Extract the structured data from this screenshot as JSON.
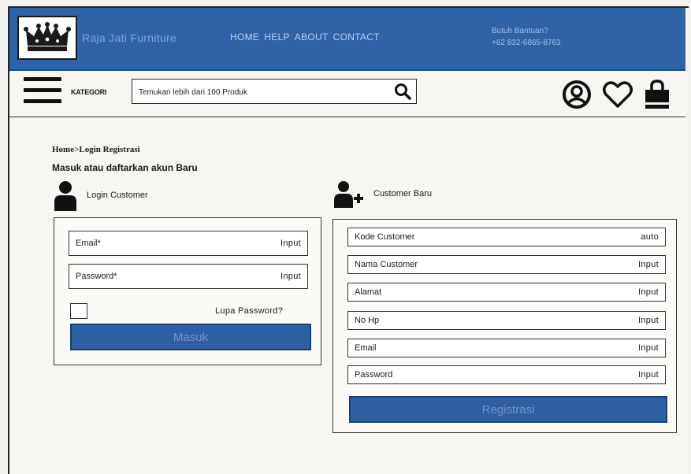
{
  "header": {
    "brand": "Raja Jati Furniture",
    "nav": [
      "HOME",
      "HELP",
      "ABOUT",
      "CONTACT"
    ],
    "help_title": "Butuh Bantuan?",
    "help_phone": "+62 832-6865-8763",
    "logo_icon": "crown-icon",
    "bar_color": "#2f63a8"
  },
  "searchbar": {
    "kategori_label": "KATEGORI",
    "placeholder": "Temukan lebih dari 100 Produk",
    "menu_icon": "hamburger-icon",
    "search_icon": "search-icon",
    "action_icons": [
      "user-icon",
      "heart-icon",
      "shopping-bag-icon"
    ]
  },
  "breadcrumb": "Home>Login Registrasi",
  "page_title": "Masuk atau daftarkan akun Baru",
  "login": {
    "title": "Login Customer",
    "icon": "user-icon",
    "fields": [
      {
        "label": "Email*",
        "value": "Input"
      },
      {
        "label": "Password*",
        "value": "Input"
      }
    ],
    "forgot_label": "Lupa Password?",
    "submit_label": "Masuk"
  },
  "register": {
    "title": "Customer Baru",
    "icon": "add-user-icon",
    "fields": [
      {
        "label": "Kode Customer",
        "value": "auto"
      },
      {
        "label": "Nama Customer",
        "value": "Input"
      },
      {
        "label": "Alamat",
        "value": "Input"
      },
      {
        "label": "No Hp",
        "value": "Input"
      },
      {
        "label": "Email",
        "value": "Input"
      },
      {
        "label": "Password",
        "value": "Input"
      }
    ],
    "submit_label": "Registrasi"
  },
  "colors": {
    "button": "#2f5fa3",
    "accent_text": "#6f95cf"
  }
}
